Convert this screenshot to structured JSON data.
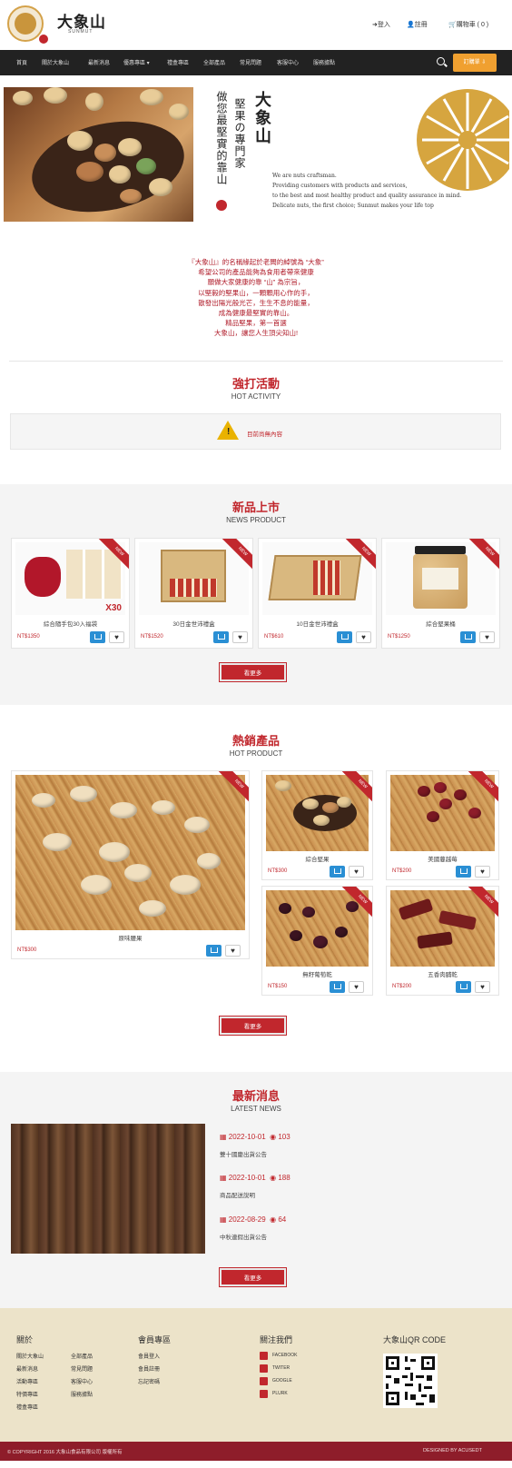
{
  "header": {
    "logo_title": "大象山",
    "logo_subtitle": "SUNMUT",
    "links": {
      "login": "登入",
      "register": "註冊",
      "cart": "購物車 ( 0 )"
    }
  },
  "nav": {
    "items": [
      "首頁",
      "關於大象山",
      "最新消息",
      "優惠專區 ▾",
      "禮盒專區",
      "全部產品",
      "常見問題",
      "客服中心",
      "服務據點"
    ],
    "order_button": "訂購單"
  },
  "hero": {
    "title": "大象山",
    "line1": "堅果の專門家",
    "line2": "做您最堅實的靠山",
    "english": [
      "We are nuts craftsman.",
      "Providing customers with products and services,",
      "to the best and most healthy product and quality assurance in mind.",
      "Delicate nuts, the first choice; Sunmut makes your life top"
    ]
  },
  "about": {
    "lines": [
      "『大象山』的名稱緣起於老闆的綽號為 “大象”",
      "希望公司的產品能夠為食用者帶來健康",
      "願做大家健康的靠 “山” 為宗旨，",
      "以堅毅的堅果山，一顆顆用心作的手，",
      "散發出陽光般光芒，生生不息的能量，",
      "成為健康最堅實的靠山。",
      "精品堅果，第一首選",
      "大象山，讓您人生頂尖知山!"
    ]
  },
  "hot_activity": {
    "title": "強打活動",
    "subtitle": "HOT ACTIVITY",
    "notice": "目前尚無內容"
  },
  "new_products": {
    "title": "新品上市",
    "subtitle": "NEWS PRODUCT",
    "badge": "NEW",
    "items": [
      {
        "name": "綜合隨手包30入福袋",
        "price": "NT$1350",
        "img_label": "X30"
      },
      {
        "name": "30日金世沛禮盒",
        "price": "NT$1520",
        "img_label": ""
      },
      {
        "name": "10日金世沛禮盒",
        "price": "NT$610",
        "img_label": ""
      },
      {
        "name": "綜合堅果桶",
        "price": "NT$1250",
        "img_label": ""
      }
    ],
    "more": "看更多"
  },
  "hot_products": {
    "title": "熱銷產品",
    "subtitle": "HOT PRODUCT",
    "badge": "NEW",
    "featured": {
      "name": "原味腰果",
      "price": "NT$300"
    },
    "items": [
      {
        "name": "綜合堅果",
        "price": "NT$300"
      },
      {
        "name": "美國蔓越莓",
        "price": "NT$200"
      },
      {
        "name": "無籽葡萄乾",
        "price": "NT$150"
      },
      {
        "name": "五香肉脯乾",
        "price": "NT$200"
      }
    ],
    "more": "看更多"
  },
  "news": {
    "title": "最新消息",
    "subtitle": "LATEST NEWS",
    "items": [
      {
        "date": "2022-10-01",
        "views": "103",
        "title": "雙十國慶出貨公告"
      },
      {
        "date": "2022-10-01",
        "views": "188",
        "title": "商品配送說明"
      },
      {
        "date": "2022-08-29",
        "views": "64",
        "title": "中秋連假出貨公告"
      }
    ],
    "more": "看更多"
  },
  "footer": {
    "about_head": "關於",
    "about_col1": [
      "關於大象山",
      "最新消息",
      "活動專區",
      "特價專區",
      "禮盒專區"
    ],
    "about_col2": [
      "全部產品",
      "常見問題",
      "客服中心",
      "服務據點"
    ],
    "member_head": "會員專區",
    "member_links": [
      "會員登入",
      "會員註冊",
      "忘記密碼"
    ],
    "follow_head": "關注我們",
    "social": [
      "FACEBOOK",
      "TWITER",
      "GOOGLE",
      "PLURK"
    ],
    "qr_head": "大象山QR CODE",
    "copyright": "© COPYRIGHT 2016 大象山食品有限公司 版權所有",
    "designed_by": "DESIGNED BY ACUSEDT"
  },
  "colors": {
    "brand_red": "#c1272d",
    "accent_orange": "#f0a030",
    "nav_dark": "#222222",
    "cart_blue": "#2a8fd4"
  }
}
